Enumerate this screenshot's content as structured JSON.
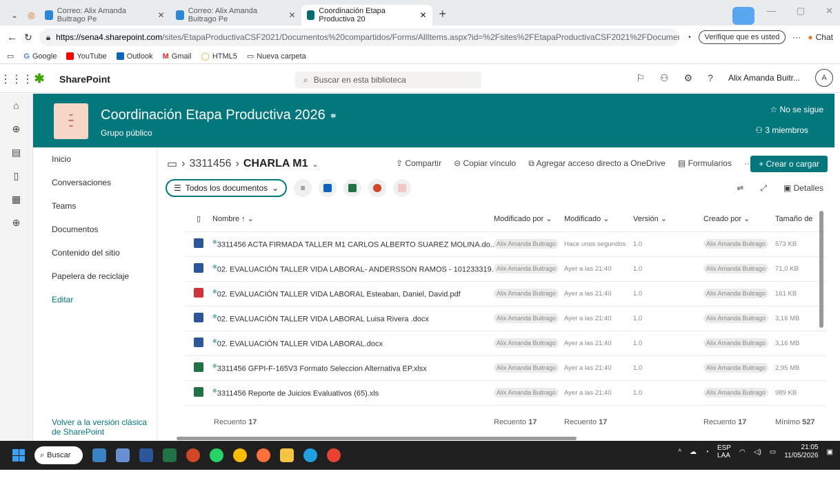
{
  "browser": {
    "tabs": [
      {
        "label": "Correo: Alix Amanda Buitrago Pe",
        "active": false
      },
      {
        "label": "Correo: Alix Amanda Buitrago Pe",
        "active": false
      },
      {
        "label": "Coordinación Etapa Productiva 20",
        "active": true
      }
    ],
    "url_host": "https://sena4.sharepoint.com",
    "url_path": "/sites/EtapaProductivaCSF2021/Documentos%20compartidos/Forms/AllItems.aspx?id=%2Fsites%2FEtapaProductivaCSF2021%2FDocumen...",
    "verify_label": "Verifique que es usted",
    "chat_label": "Chat",
    "bookmarks": [
      "Google",
      "YouTube",
      "Outlook",
      "Gmail",
      "HTML5",
      "Nueva carpeta"
    ]
  },
  "header": {
    "app_name": "SharePoint",
    "search_placeholder": "Buscar en esta biblioteca",
    "user_name": "Alix Amanda Buitr...",
    "avatar_initial": "A"
  },
  "site": {
    "title": "Coordinación Etapa Productiva 2026",
    "subtitle": "Grupo público",
    "follow_label": "No se sigue",
    "members_label": "3 miembros"
  },
  "nav": {
    "items": [
      "Inicio",
      "Conversaciones",
      "Teams",
      "Documentos",
      "Contenido del sitio",
      "Papelera de reciclaje"
    ],
    "edit_label": "Editar",
    "classic_label": "Volver a la versión clásica de SharePoint"
  },
  "breadcrumb": {
    "parent": "3311456",
    "current": "CHARLA M1"
  },
  "commands": {
    "share": "Compartir",
    "copy_link": "Copiar vínculo",
    "add_shortcut": "Agregar acceso directo a OneDrive",
    "forms": "Formularios",
    "more": "···",
    "upload": "+ Crear o cargar",
    "view_label": "Todos los documentos",
    "details": "Detalles"
  },
  "columns": {
    "name": "Nombre ↑",
    "modified_by": "Modificado por",
    "modified": "Modificado",
    "version": "Versión",
    "created_by": "Creado por",
    "size": "Tamaño de"
  },
  "files": [
    {
      "name": "3311456 ACTA FIRMADA TALLER M1  CARLOS ALBERTO SUAREZ MOLINA.do...",
      "type": "word",
      "modified_by": "Alix Amanda Buitrago",
      "modified": "Hace unos segundos",
      "version": "1.0",
      "created_by": "Alix Amanda Buitrago",
      "size": "573 KB"
    },
    {
      "name": "02. EVALUACIÓN TALLER VIDA LABORAL- ANDERSSON RAMOS - 101233319...",
      "type": "word",
      "modified_by": "Alix Amanda Buitrago",
      "modified": "Ayer a las 21:40",
      "version": "1.0",
      "created_by": "Alix Amanda Buitrago",
      "size": "71,0 KB"
    },
    {
      "name": "02. EVALUACIÓN TALLER VIDA LABORAL Esteaban, Daniel, David.pdf",
      "type": "pdf",
      "modified_by": "Alix Amanda Buitrago",
      "modified": "Ayer a las 21:40",
      "version": "1.0",
      "created_by": "Alix Amanda Buitrago",
      "size": "161 KB"
    },
    {
      "name": "02. EVALUACIÓN TALLER VIDA LABORAL Luisa Rivera .docx",
      "type": "word",
      "modified_by": "Alix Amanda Buitrago",
      "modified": "Ayer a las 21:40",
      "version": "1.0",
      "created_by": "Alix Amanda Buitrago",
      "size": "3,16 MB"
    },
    {
      "name": "02. EVALUACIÓN TALLER VIDA LABORAL.docx",
      "type": "word",
      "modified_by": "Alix Amanda Buitrago",
      "modified": "Ayer a las 21:40",
      "version": "1.0",
      "created_by": "Alix Amanda Buitrago",
      "size": "3,16 MB"
    },
    {
      "name": "3311456 GFPI-F-165V3 Formato Seleccion Alternativa EP.xlsx",
      "type": "excel",
      "modified_by": "Alix Amanda Buitrago",
      "modified": "Ayer a las 21:40",
      "version": "1.0",
      "created_by": "Alix Amanda Buitrago",
      "size": "2,95 MB"
    },
    {
      "name": "3311456 Reporte de Juicios Evaluativos (65).xls",
      "type": "excel",
      "modified_by": "Alix Amanda Buitrago",
      "modified": "Ayer a las 21:40",
      "version": "1.0",
      "created_by": "Alix Amanda Buitrago",
      "size": "989 KB"
    }
  ],
  "footer": {
    "count_label": "Recuento",
    "count_value": "17",
    "min_label": "Mínimo",
    "min_value": "527"
  },
  "taskbar": {
    "search_label": "Buscar",
    "lang": "ESP",
    "lang_sub": "LAA",
    "time": "21:05",
    "date": "11/05/2026"
  },
  "colors": {
    "brand": "#03787c",
    "word": "#2b579a",
    "excel": "#217346",
    "pdf": "#d13438"
  }
}
